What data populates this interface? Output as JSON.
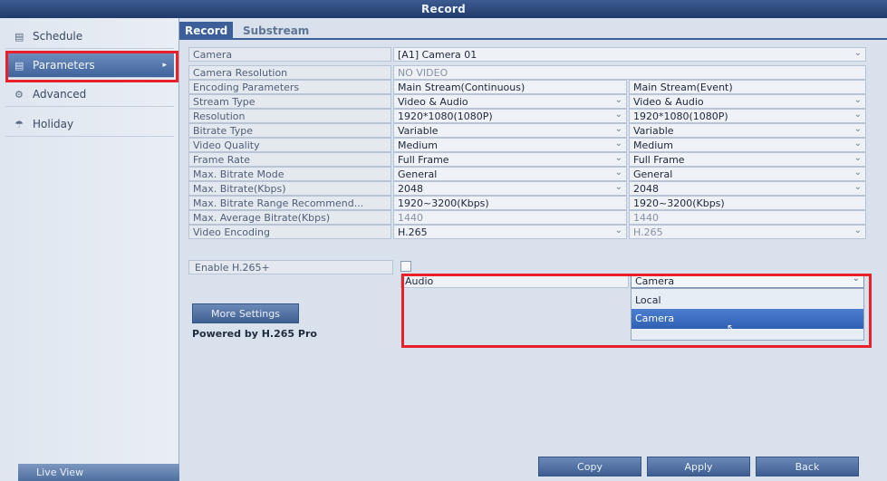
{
  "window": {
    "title": "Record"
  },
  "sidebar": {
    "items": [
      {
        "icon": "calendar-icon",
        "label": "Schedule"
      },
      {
        "icon": "sliders-icon",
        "label": "Parameters"
      },
      {
        "icon": "gear-icon",
        "label": "Advanced"
      },
      {
        "icon": "holiday-icon",
        "label": "Holiday"
      }
    ],
    "live_view": "Live View"
  },
  "tabs": {
    "record": "Record",
    "substream": "Substream"
  },
  "params": {
    "camera_label": "Camera",
    "camera_value": "[A1] Camera 01",
    "resolution_label": "Camera Resolution",
    "resolution_value": "NO VIDEO",
    "encoding_label": "Encoding Parameters",
    "encoding_c1": "Main Stream(Continuous)",
    "encoding_c2": "Main Stream(Event)",
    "rows": [
      {
        "label": "Stream Type",
        "c1": "Video & Audio",
        "c2": "Video & Audio"
      },
      {
        "label": "Resolution",
        "c1": "1920*1080(1080P)",
        "c2": "1920*1080(1080P)"
      },
      {
        "label": "Bitrate Type",
        "c1": "Variable",
        "c2": "Variable"
      },
      {
        "label": "Video Quality",
        "c1": "Medium",
        "c2": "Medium"
      },
      {
        "label": "Frame Rate",
        "c1": "Full Frame",
        "c2": "Full Frame"
      },
      {
        "label": "Max. Bitrate Mode",
        "c1": "General",
        "c2": "General"
      },
      {
        "label": "Max. Bitrate(Kbps)",
        "c1": "2048",
        "c2": "2048"
      },
      {
        "label": "Max. Bitrate Range Recommend...",
        "c1": "1920~3200(Kbps)",
        "c2": "1920~3200(Kbps)"
      },
      {
        "label": "Max. Average Bitrate(Kbps)",
        "c1": "1440",
        "c2": "1440"
      },
      {
        "label": "Video Encoding",
        "c1": "H.265",
        "c2": "H.265"
      }
    ],
    "enable_h265_label": "Enable H.265+",
    "audio_label": "Audio",
    "audio_value": "Camera",
    "audio_options": [
      "Local",
      "Camera"
    ]
  },
  "buttons": {
    "more_settings": "More Settings",
    "powered": "Powered by H.265 Pro",
    "copy": "Copy",
    "apply": "Apply",
    "back": "Back"
  }
}
